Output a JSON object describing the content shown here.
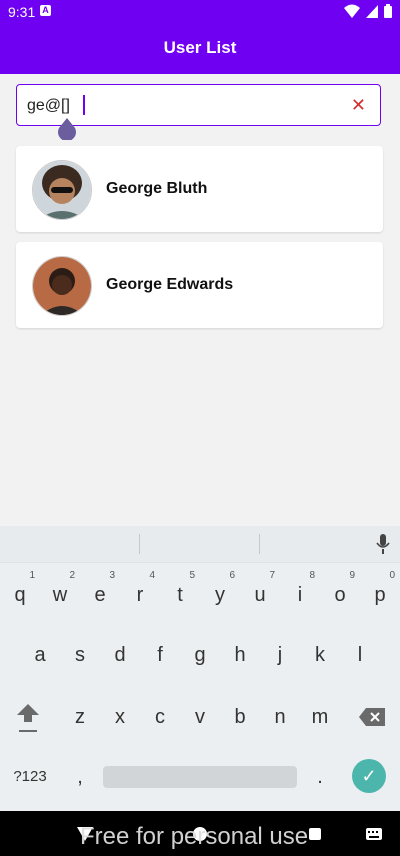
{
  "status": {
    "time": "9:31"
  },
  "app": {
    "title": "User List",
    "accent": "#6f00f2"
  },
  "search": {
    "value": "ge@[]",
    "clear_icon": "close-icon"
  },
  "users": [
    {
      "name": "George Bluth",
      "avatar": "avatar-george-bluth"
    },
    {
      "name": "George Edwards",
      "avatar": "avatar-george-edwards"
    }
  ],
  "keyboard": {
    "row1": [
      {
        "key": "q",
        "num": "1"
      },
      {
        "key": "w",
        "num": "2"
      },
      {
        "key": "e",
        "num": "3"
      },
      {
        "key": "r",
        "num": "4"
      },
      {
        "key": "t",
        "num": "5"
      },
      {
        "key": "y",
        "num": "6"
      },
      {
        "key": "u",
        "num": "7"
      },
      {
        "key": "i",
        "num": "8"
      },
      {
        "key": "o",
        "num": "9"
      },
      {
        "key": "p",
        "num": "0"
      }
    ],
    "row2": [
      "a",
      "s",
      "d",
      "f",
      "g",
      "h",
      "j",
      "k",
      "l"
    ],
    "row3": [
      "z",
      "x",
      "c",
      "v",
      "b",
      "n",
      "m"
    ],
    "symbols": "?123",
    "comma": ",",
    "period": ".",
    "enter_icon": "check-icon",
    "enter_color": "#4db6ac"
  },
  "watermark": "Free for personal use"
}
